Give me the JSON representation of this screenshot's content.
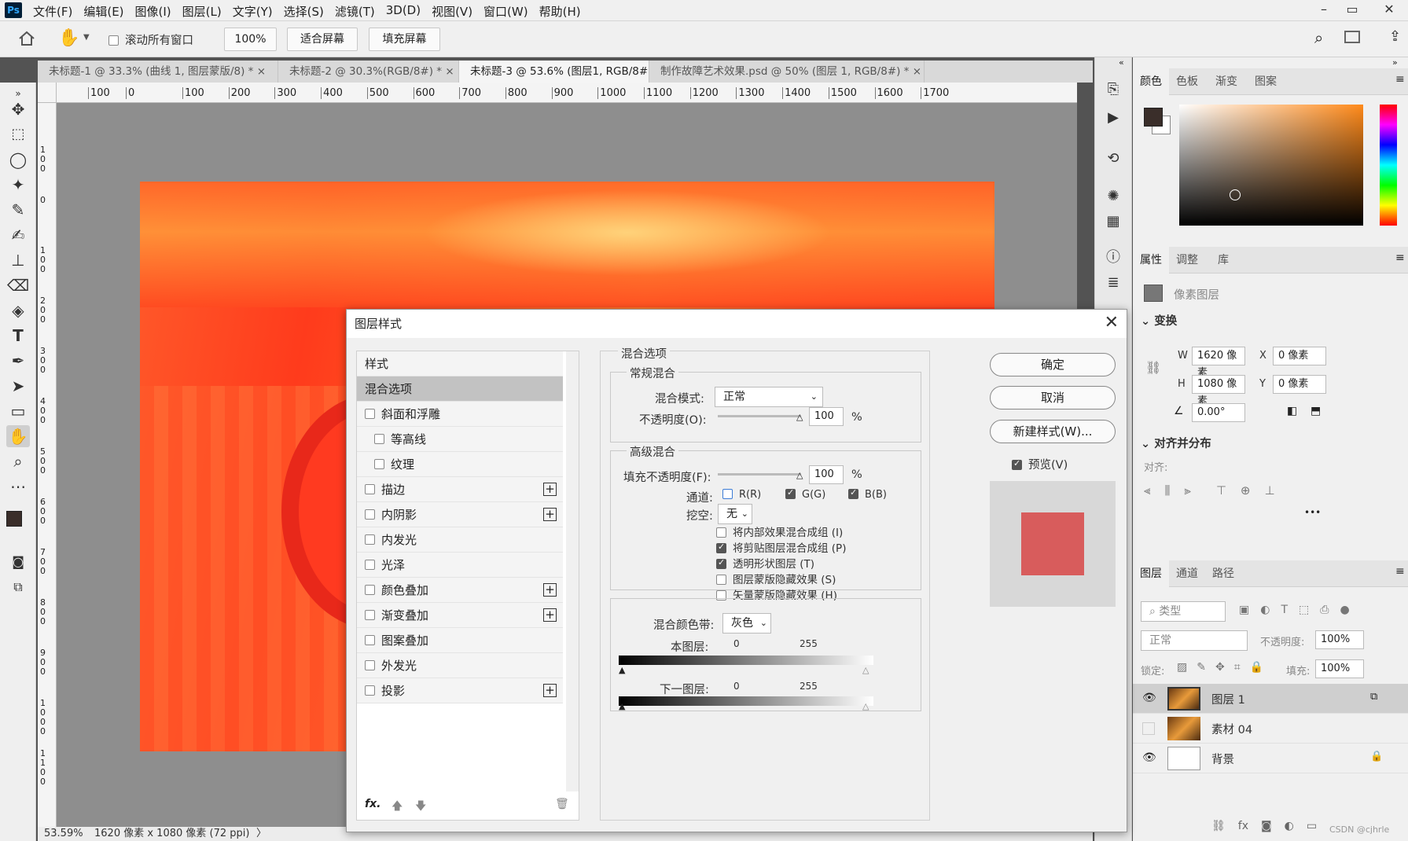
{
  "app": {
    "logo": "Ps"
  },
  "menu": [
    "文件(F)",
    "编辑(E)",
    "图像(I)",
    "图层(L)",
    "文字(Y)",
    "选择(S)",
    "滤镜(T)",
    "3D(D)",
    "视图(V)",
    "窗口(W)",
    "帮助(H)"
  ],
  "window_controls": {
    "minimize": "–",
    "restore": "▭",
    "close": "✕"
  },
  "options": {
    "scroll_all_label": "滚动所有窗口",
    "zoom_value": "100%",
    "fit_screen": "适合屏幕",
    "fill_screen": "填充屏幕"
  },
  "tabs": [
    {
      "label": "未标题-1 @ 33.3% (曲线 1, 图层蒙版/8) *",
      "close": "×"
    },
    {
      "label": "未标题-2 @ 30.3%(RGB/8#) *",
      "close": "×"
    },
    {
      "label": "未标题-3 @ 53.6% (图层1, RGB/8#) *",
      "close": "×"
    },
    {
      "label": "制作故障艺术效果.psd @ 50% (图层 1, RGB/8#) *",
      "close": "×"
    }
  ],
  "ruler_h": [
    "100",
    "0",
    "100",
    "200",
    "300",
    "400",
    "500",
    "600",
    "700",
    "800",
    "900",
    "1000",
    "1100",
    "1200",
    "1300",
    "1400",
    "1500",
    "1600",
    "1700"
  ],
  "ruler_v": [
    "0",
    "100",
    "0",
    "100",
    "200",
    "300",
    "400",
    "500",
    "600",
    "700",
    "800",
    "900",
    "1000",
    "1100"
  ],
  "status": {
    "zoom": "53.59%",
    "info": "1620 像素 x 1080 像素 (72 ppi)",
    "arrow": "〉"
  },
  "dialog": {
    "title": "图层样式",
    "close": "✕",
    "styles_header": "样式",
    "items": [
      {
        "label": "混合选项",
        "checkbox": false,
        "checked": false,
        "plus": false,
        "selected": true,
        "indent": false
      },
      {
        "label": "斜面和浮雕",
        "checkbox": true,
        "checked": false,
        "plus": false,
        "selected": false,
        "indent": false
      },
      {
        "label": "等高线",
        "checkbox": true,
        "checked": false,
        "plus": false,
        "selected": false,
        "indent": true
      },
      {
        "label": "纹理",
        "checkbox": true,
        "checked": false,
        "plus": false,
        "selected": false,
        "indent": true
      },
      {
        "label": "描边",
        "checkbox": true,
        "checked": false,
        "plus": true,
        "selected": false,
        "indent": false
      },
      {
        "label": "内阴影",
        "checkbox": true,
        "checked": false,
        "plus": true,
        "selected": false,
        "indent": false
      },
      {
        "label": "内发光",
        "checkbox": true,
        "checked": false,
        "plus": false,
        "selected": false,
        "indent": false
      },
      {
        "label": "光泽",
        "checkbox": true,
        "checked": false,
        "plus": false,
        "selected": false,
        "indent": false
      },
      {
        "label": "颜色叠加",
        "checkbox": true,
        "checked": false,
        "plus": true,
        "selected": false,
        "indent": false
      },
      {
        "label": "渐变叠加",
        "checkbox": true,
        "checked": false,
        "plus": true,
        "selected": false,
        "indent": false
      },
      {
        "label": "图案叠加",
        "checkbox": true,
        "checked": false,
        "plus": false,
        "selected": false,
        "indent": false
      },
      {
        "label": "外发光",
        "checkbox": true,
        "checked": false,
        "plus": false,
        "selected": false,
        "indent": false
      },
      {
        "label": "投影",
        "checkbox": true,
        "checked": false,
        "plus": true,
        "selected": false,
        "indent": false
      }
    ],
    "footer_fx": "fx.",
    "blend_options_title": "混合选项",
    "general_blend": "常规混合",
    "blend_mode_label": "混合模式:",
    "blend_mode_value": "正常",
    "opacity_label": "不透明度(O):",
    "opacity_value": "100",
    "percent": "%",
    "advanced_blend": "高级混合",
    "fill_opacity_label": "填充不透明度(F):",
    "fill_opacity_value": "100",
    "channels_label": "通道:",
    "ch_r": "R(R)",
    "ch_g": "G(G)",
    "ch_b": "B(B)",
    "knockout_label": "挖空:",
    "knockout_value": "无",
    "opt1": "将内部效果混合成组 (I)",
    "opt2": "将剪贴图层混合成组 (P)",
    "opt3": "透明形状图层 (T)",
    "opt4": "图层蒙版隐藏效果 (S)",
    "opt5": "矢量蒙版隐藏效果 (H)",
    "blend_if_label": "混合颜色带:",
    "blend_if_value": "灰色",
    "this_layer": "本图层:",
    "under_layer": "下一图层:",
    "range_low": "0",
    "range_high": "255",
    "ok": "确定",
    "cancel": "取消",
    "new_style": "新建样式(W)...",
    "preview": "预览(V)",
    "preview_color": "#d85c5c"
  },
  "color_panel": {
    "tabs": [
      "颜色",
      "色板",
      "渐变",
      "图案"
    ]
  },
  "props_panel": {
    "tabs": [
      "属性",
      "调整",
      "库"
    ],
    "pixel_layer": "像素图层",
    "transform": "变换",
    "w_label": "W",
    "w_value": "1620 像素",
    "h_label": "H",
    "h_value": "1080 像素",
    "x_label": "X",
    "x_value": "0 像素",
    "y_label": "Y",
    "y_value": "0 像素",
    "angle_value": "0.00°",
    "align": "对齐并分布",
    "align_sub": "对齐:",
    "more": "•••"
  },
  "layers_panel": {
    "tabs": [
      "图层",
      "通道",
      "路径"
    ],
    "kind": "类型",
    "mode": "正常",
    "opacity_label": "不透明度:",
    "opacity_value": "100%",
    "lock_label": "锁定:",
    "fill_label": "填充:",
    "fill_value": "100%",
    "layers": [
      {
        "name": "图层 1",
        "visible": true
      },
      {
        "name": "素材 04",
        "visible": false
      },
      {
        "name": "背景",
        "visible": true
      }
    ],
    "watermark": "CSDN @cjhrle"
  }
}
